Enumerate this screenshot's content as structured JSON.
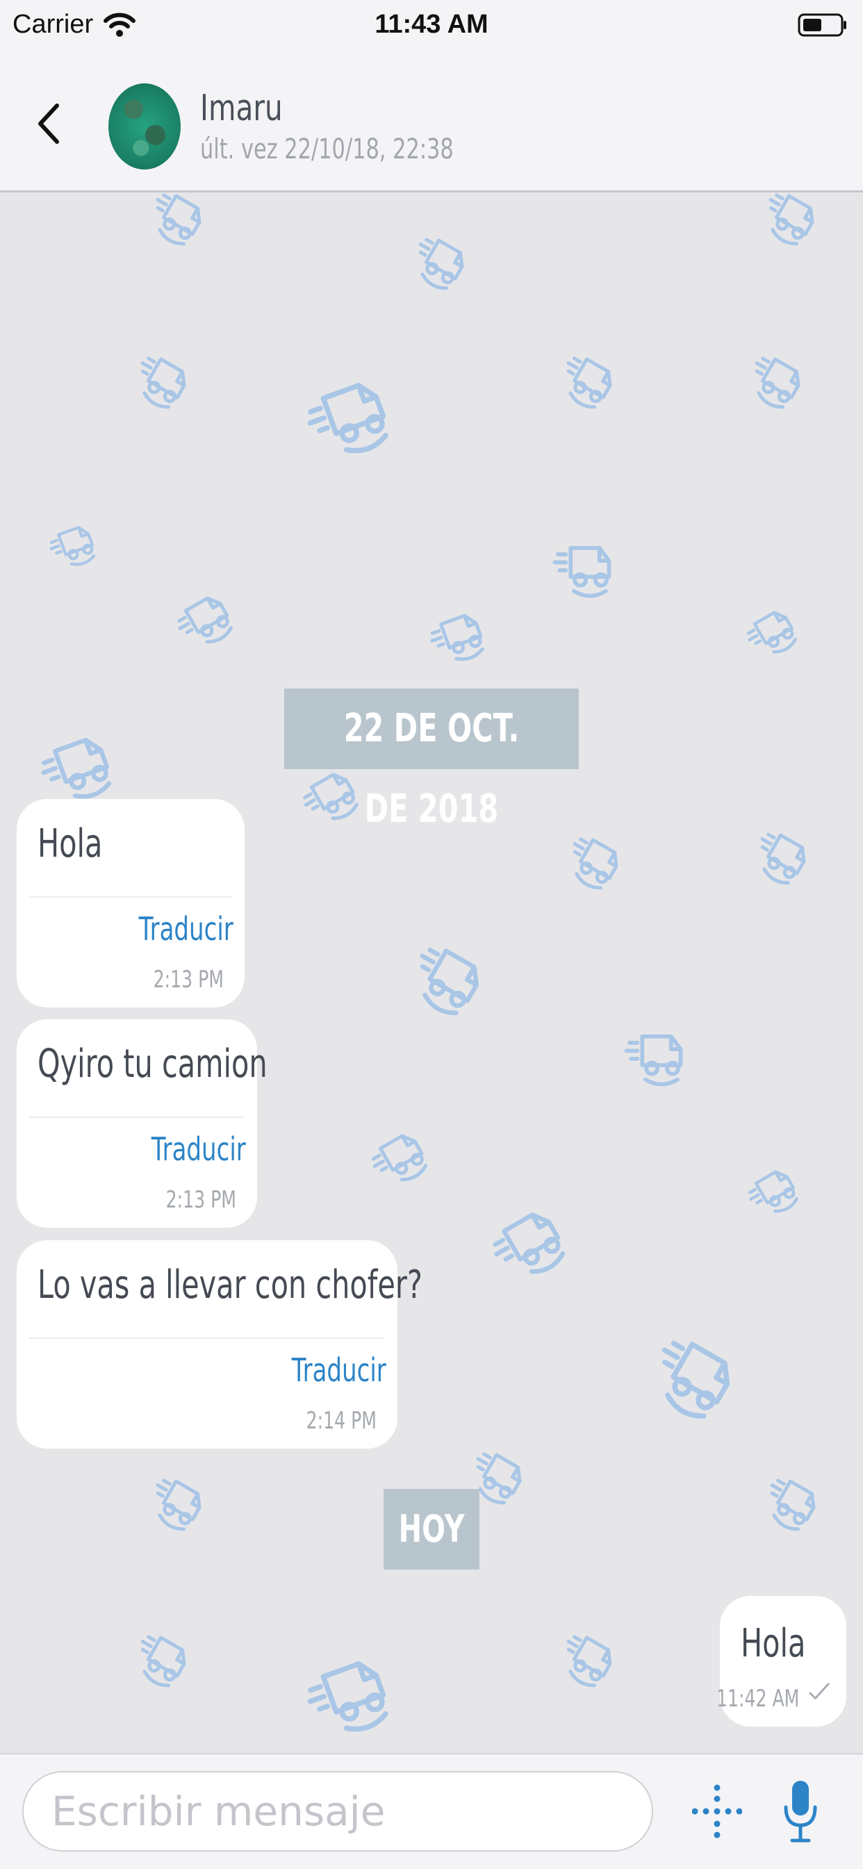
{
  "status_bar": {
    "carrier": "Carrier",
    "time": "11:43 AM"
  },
  "header": {
    "name": "Imaru",
    "last_seen": "últ. vez 22/10/18, 22:38"
  },
  "chat": {
    "date_chip_1": "22 DE OCT. DE 2018",
    "date_chip_2": "HOY",
    "messages": [
      {
        "text": "Hola",
        "translate": "Traducir",
        "time": "2:13 PM"
      },
      {
        "text": "Qyiro tu camion",
        "translate": "Traducir",
        "time": "2:13 PM"
      },
      {
        "text": "Lo vas a llevar con chofer?",
        "translate": "Traducir",
        "time": "2:14 PM"
      }
    ],
    "outgoing": {
      "text": "Hola",
      "time": "11:42 AM"
    }
  },
  "input_bar": {
    "placeholder": "Escribir mensaje"
  },
  "colors": {
    "pattern_icon": "#a9c6e6",
    "link": "#2c84c7",
    "date_chip": "#b9c5cc",
    "chat_background": "#e6e6e9"
  },
  "icons": {
    "back": "chevron-left-icon",
    "wifi": "wifi-icon",
    "battery": "battery-icon",
    "attach": "attach-icon",
    "mic": "microphone-icon",
    "read_receipt": "checkmark-icon",
    "pattern": "delivery-truck-icon"
  }
}
